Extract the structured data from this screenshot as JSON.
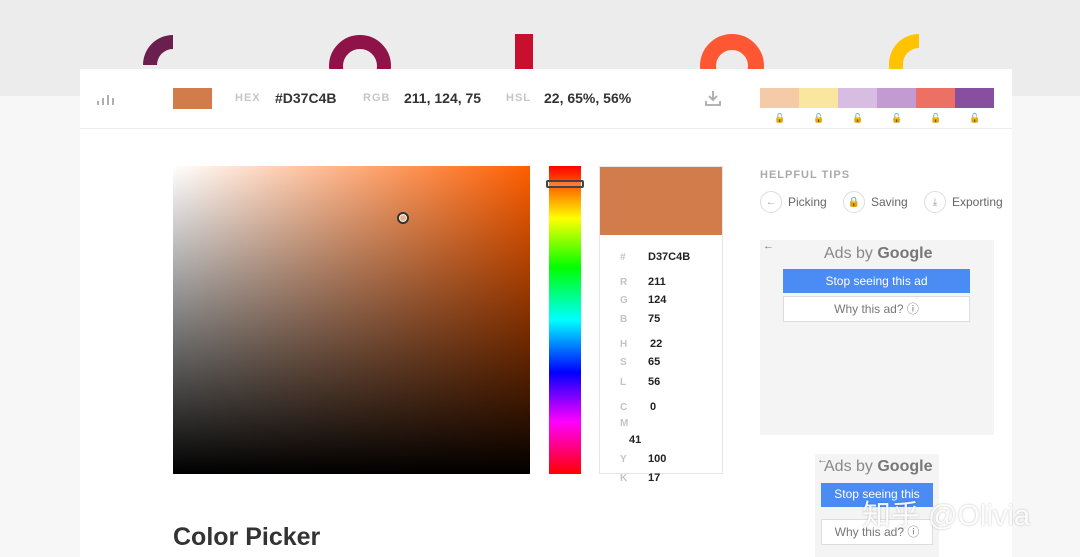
{
  "colors": {
    "current": "#D37C4B",
    "palette": [
      "#F5CBA7",
      "#F9E79F",
      "#D7BDE2",
      "#C39BD3",
      "#EC7063",
      "#884EA0"
    ],
    "deco": [
      "#6B1F4E",
      "#8E1349",
      "#C8102E",
      "#FF5733",
      "#FFC300"
    ],
    "ad_button": "#4B8BF4"
  },
  "toolbar": {
    "hex_label": "HEX",
    "hex_value": "#D37C4B",
    "rgb_label": "RGB",
    "rgb_value": "211, 124, 75",
    "hsl_label": "HSL",
    "hsl_value": "22, 65%, 56%",
    "icons": [
      "bars-icon",
      "download-icon",
      "lock-icon"
    ]
  },
  "picker": {
    "hue": 22,
    "saturation_value_pct": 65
  },
  "info": {
    "hash_label": "#",
    "hash_value": "D37C4B",
    "r_label": "R",
    "r_value": "211",
    "g_label": "G",
    "g_value": "124",
    "b_label": "B",
    "b_value": "75",
    "h_label": "H",
    "h_value": "22",
    "s_label": "S",
    "s_value": "65",
    "l_label": "L",
    "l_value": "56",
    "c_label": "C",
    "c_value": "0",
    "m_label": "M",
    "m_value": "41",
    "y_label": "Y",
    "y_value": "100",
    "k_label": "K",
    "k_value": "17"
  },
  "tips": {
    "title": "HELPFUL TIPS",
    "items": [
      {
        "label": "Picking",
        "icon": "arrow-left-icon"
      },
      {
        "label": "Saving",
        "icon": "lock-icon"
      },
      {
        "label": "Exporting",
        "icon": "download-icon"
      }
    ]
  },
  "ads": {
    "back": "←",
    "title_prefix": "Ads by ",
    "title_brand": "Google",
    "stop_label": "Stop seeing this ad",
    "stop_label_short": "Stop seeing this",
    "why_label": "Why this ad? ⓘ"
  },
  "page": {
    "title": "Color Picker"
  },
  "watermark": "知乎 @Olivia"
}
